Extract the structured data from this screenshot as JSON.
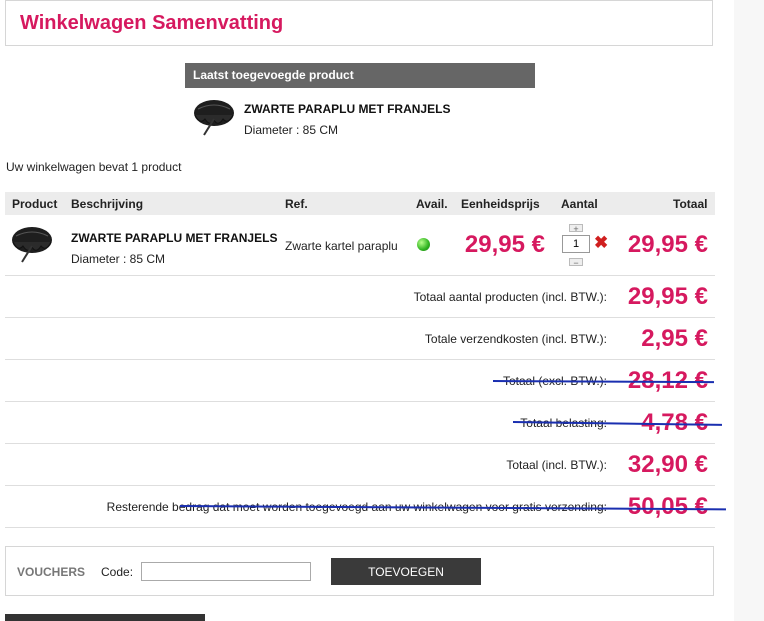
{
  "page": {
    "title": "Winkelwagen Samenvatting"
  },
  "last_added": {
    "header": "Laatst toegevoegde product",
    "product_name": "ZWARTE PARAPLU MET FRANJELS",
    "product_attr": "Diameter : 85 CM",
    "thumb_icon": "umbrella-thumbnail"
  },
  "cart_count_text": "Uw winkelwagen bevat 1 product",
  "table": {
    "headers": {
      "product": "Product",
      "description": "Beschrijving",
      "ref": "Ref.",
      "avail": "Avail.",
      "unit_price": "Eenheidsprijs",
      "qty": "Aantal",
      "total": "Totaal"
    },
    "row": {
      "name": "ZWARTE PARAPLU MET FRANJELS",
      "attr": "Diameter : 85 CM",
      "ref": "Zwarte kartel paraplu",
      "avail_color": "#2fb320",
      "unit_price": "29,95 €",
      "qty": "1",
      "qty_up": "+",
      "qty_down": "−",
      "remove": "✖",
      "total": "29,95 €"
    }
  },
  "summary": [
    {
      "label": "Totaal aantal producten (incl. BTW.):",
      "value": "29,95 €",
      "struck": false
    },
    {
      "label": "Totale verzendkosten (incl. BTW.):",
      "value": "2,95 €",
      "struck": false
    },
    {
      "label": "Totaal (excl. BTW.):",
      "value": "28,12 €",
      "struck": true
    },
    {
      "label": "Totaal belasting:",
      "value": "4,78 €",
      "struck": true
    },
    {
      "label": "Totaal (incl. BTW.):",
      "value": "32,90 €",
      "struck": false
    },
    {
      "label": "Resterende bedrag dat moet worden toegevoegd aan uw winkelwagen voor gratis verzending:",
      "value": "50,05 €",
      "struck": true
    }
  ],
  "vouchers": {
    "label": "VOUCHERS",
    "code_label": "Code:",
    "code_value": "",
    "button": "TOEVOEGEN"
  },
  "colors": {
    "accent": "#d6195f",
    "strike": "#1a2fb0",
    "header_bg": "#666666"
  }
}
